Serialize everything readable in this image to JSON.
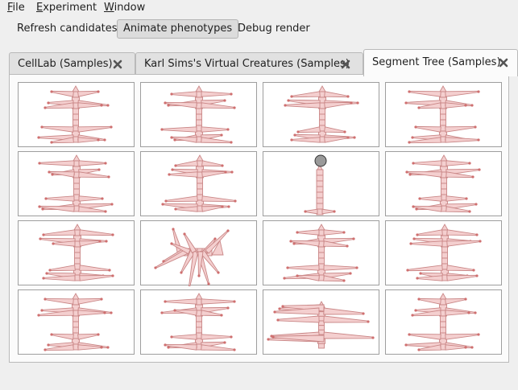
{
  "menubar": {
    "items": [
      {
        "mnemonic": "F",
        "rest": "ile"
      },
      {
        "mnemonic": "E",
        "rest": "xperiment"
      },
      {
        "mnemonic": "W",
        "rest": "indow"
      }
    ]
  },
  "toolbar": {
    "refresh_label": "Refresh candidates",
    "animate_label": "Animate phenotypes",
    "debug_label": "Debug render"
  },
  "tabs": [
    {
      "label": "CellLab (Samples)",
      "active": false
    },
    {
      "label": "Karl Sims's Virtual Creatures (Samples)",
      "active": false
    },
    {
      "label": "Segment Tree (Samples)",
      "active": true
    }
  ],
  "colors": {
    "creature_fill": "#f4cfcf",
    "creature_stroke": "#c98686",
    "joint": "#cf6f6f",
    "selected_node": "#9a9a9a",
    "close_icon": "#555555"
  },
  "icons": {
    "close": "close-icon"
  },
  "grid": {
    "rows": 4,
    "cols": 4,
    "phenotypes": [
      "upright",
      "upright",
      "upright",
      "upright",
      "upright",
      "upright",
      "stalk-with-node",
      "upright",
      "upright",
      "tangled",
      "upright",
      "upright",
      "upright",
      "upright",
      "wide-arms",
      "upright"
    ]
  }
}
